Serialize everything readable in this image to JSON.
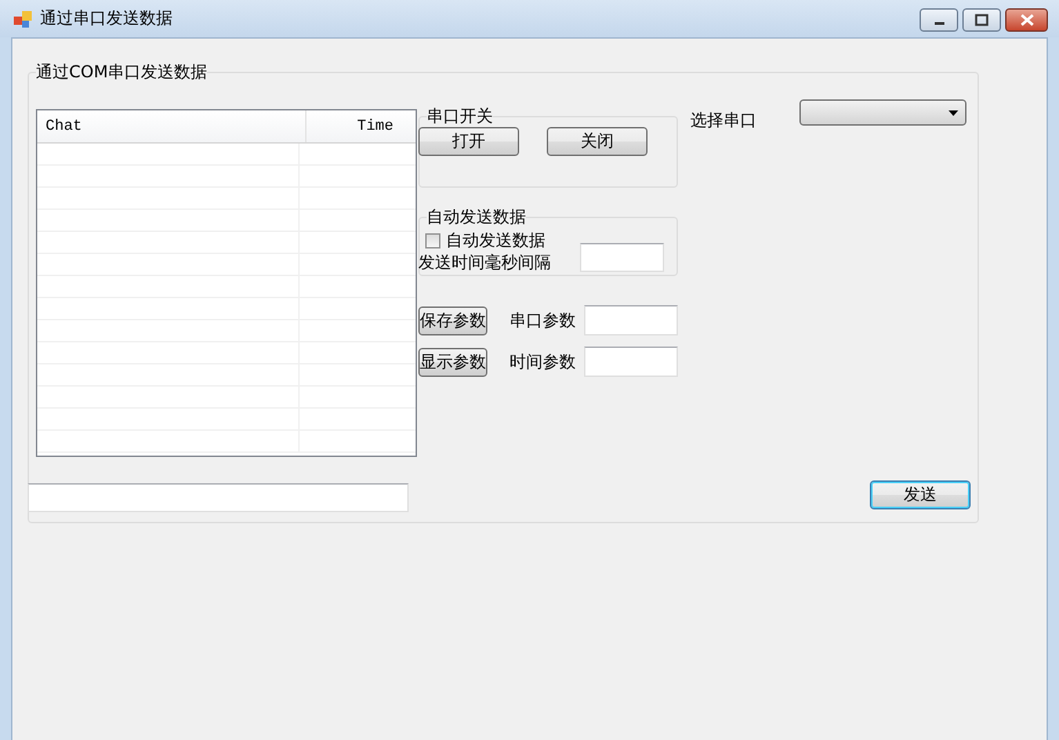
{
  "window": {
    "title": "通过串口发送数据"
  },
  "main_group": {
    "title": "通过COM串口发送数据"
  },
  "chat_list": {
    "columns": [
      "Chat",
      "Time"
    ]
  },
  "port_switch": {
    "title": "串口开关",
    "buttons": [
      "打开",
      "关闭"
    ]
  },
  "auto_send": {
    "title": "自动发送数据",
    "checkbox": {
      "label": "自动发送数据",
      "checked": false
    },
    "interval_label": "发送时间毫秒间隔"
  },
  "param_rows": [
    {
      "button": "保存参数",
      "label": "串口参数"
    },
    {
      "button": "显示参数",
      "label": "时间参数"
    }
  ],
  "port_select": {
    "label": "选择串口"
  },
  "send_button": "发送"
}
